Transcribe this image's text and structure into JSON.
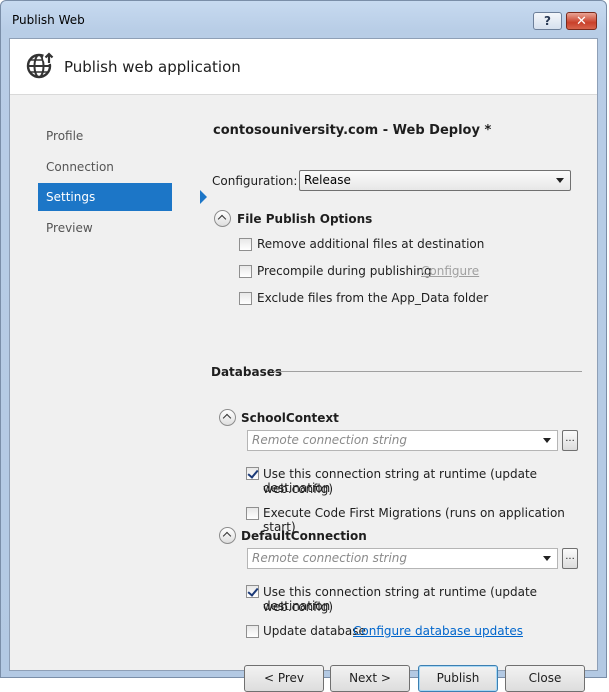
{
  "window": {
    "title": "Publish Web"
  },
  "header": {
    "title": "Publish web application",
    "icon": "globe-publish-icon"
  },
  "nav": {
    "items": [
      {
        "label": "Profile",
        "active": false
      },
      {
        "label": "Connection",
        "active": false
      },
      {
        "label": "Settings",
        "active": true
      },
      {
        "label": "Preview",
        "active": false
      }
    ]
  },
  "settings": {
    "heading": "contosouniversity.com - Web Deploy *",
    "configuration": {
      "label": "Configuration:",
      "value": "Release"
    },
    "file_publish": {
      "title": "File Publish Options",
      "remove_files": {
        "label": "Remove additional files at destination",
        "checked": false
      },
      "precompile": {
        "label": "Precompile during publishing",
        "checked": false,
        "configure_link": "Configure"
      },
      "exclude_app_data": {
        "label": "Exclude files from the App_Data folder",
        "checked": false
      }
    },
    "databases": {
      "title": "Databases",
      "school": {
        "name": "SchoolContext",
        "placeholder": "Remote connection string",
        "use_runtime_line1": "Use this connection string at runtime (update destination",
        "use_runtime_line2": "web.config)",
        "use_runtime_checked": true,
        "migrations_label": "Execute Code First Migrations (runs on application start)",
        "migrations_checked": false
      },
      "default": {
        "name": "DefaultConnection",
        "placeholder": "Remote connection string",
        "use_runtime_line1": "Use this connection string at runtime (update destination",
        "use_runtime_line2": "web.config)",
        "use_runtime_checked": true,
        "update_db_label": "Update database",
        "update_db_checked": false,
        "configure_updates_link": "Configure database updates"
      }
    }
  },
  "buttons": {
    "prev": "< Prev",
    "next": "Next >",
    "publish": "Publish",
    "close": "Close"
  },
  "titlebar_buttons": {
    "help": "?",
    "close": "✕"
  },
  "colors": {
    "accent": "#1c76c7",
    "link": "#0066cc"
  }
}
